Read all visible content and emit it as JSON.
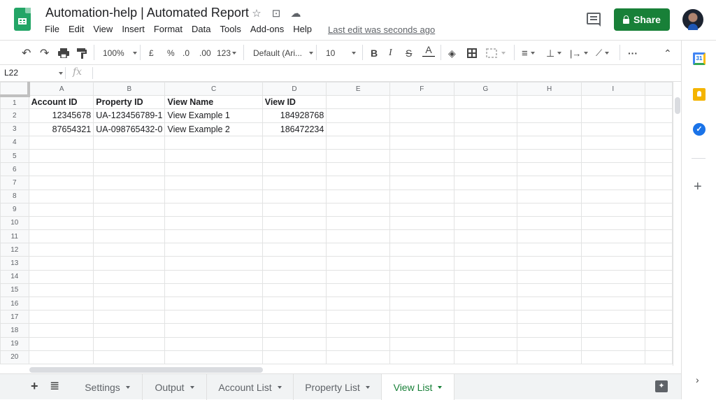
{
  "header": {
    "title": "Automation-help | Automated Report",
    "title_icons": [
      "star-icon",
      "move-to-folder-icon",
      "cloud-status-icon"
    ],
    "menu": [
      "File",
      "Edit",
      "View",
      "Insert",
      "Format",
      "Data",
      "Tools",
      "Add-ons",
      "Help"
    ],
    "last_edit": "Last edit was seconds ago",
    "share_label": "Share"
  },
  "toolbar": {
    "zoom": "100%",
    "currency": "£",
    "percent": "%",
    "decrease_decimal": ".0",
    "increase_decimal": ".00",
    "more_formats": "123",
    "font": "Default (Ari...",
    "font_size": "10",
    "bold": "B",
    "italic": "I",
    "strikethrough": "S",
    "text_color_label": "A",
    "text_color": "#000000",
    "more": "···"
  },
  "formula_bar": {
    "name_box": "L22",
    "fx": "fx",
    "value": ""
  },
  "sheet": {
    "columns": [
      "A",
      "B",
      "C",
      "D",
      "E",
      "F",
      "G",
      "H",
      "I"
    ],
    "row_numbers": [
      "1",
      "2",
      "3",
      "4",
      "5",
      "6",
      "7",
      "8",
      "9",
      "10",
      "11",
      "12",
      "13",
      "14",
      "15",
      "16",
      "17",
      "18",
      "19",
      "20"
    ],
    "header_row": [
      "Account ID",
      "Property ID",
      "View Name",
      "View ID"
    ],
    "rows": [
      [
        "12345678",
        "UA-123456789-1",
        "View Example 1",
        "184928768"
      ],
      [
        "87654321",
        "UA-098765432-0",
        "View Example 2",
        "186472234"
      ]
    ]
  },
  "tabs": {
    "add_label": "+",
    "all_sheets_label": "≣",
    "items": [
      "Settings",
      "Output",
      "Account List",
      "Property List",
      "View List"
    ],
    "active": "View List"
  },
  "side_panel": {
    "calendar_label": "31",
    "tasks_label": "✓",
    "add_label": "+",
    "expand_label": "›"
  },
  "colors": {
    "brand_green": "#188038",
    "sheets_green": "#23a566"
  }
}
